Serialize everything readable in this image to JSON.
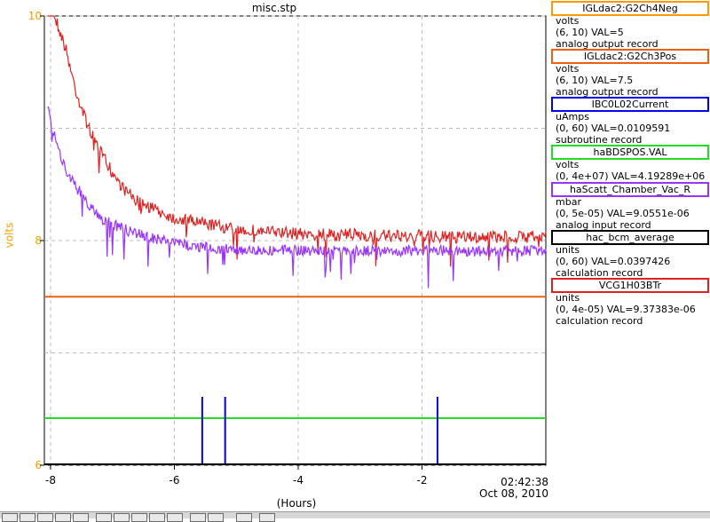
{
  "chart_data": {
    "type": "line",
    "title": "misc.stp",
    "xlabel": "(Hours)",
    "ylabel": "volts",
    "xlim": [
      -8.1,
      0
    ],
    "ylim": [
      6,
      10
    ],
    "x_ticks": [
      -8,
      -6,
      -4,
      -2
    ],
    "y_ticks": [
      6,
      8,
      10
    ],
    "timestamp": [
      "02:42:38",
      "Oct 08, 2010"
    ],
    "grid": true,
    "series": [
      {
        "name": "IGLdac2:G2Ch4Neg",
        "color": "#ff9900",
        "values": [
          5
        ]
      },
      {
        "name": "IGLdac2:G2Ch3Pos",
        "color": "#ee6010",
        "x": [
          -8.1,
          0
        ],
        "values": [
          7.5,
          7.5
        ]
      },
      {
        "name": "IBC0L02Current",
        "color": "#0000ee",
        "spikes_x": [
          -5.55,
          -5.18,
          -1.75
        ],
        "spikes_top": [
          0.0109,
          0.0109,
          0.0109
        ]
      },
      {
        "name": "haBDSPOS.VAL",
        "color": "#22dd22",
        "values": [
          4192890.0
        ]
      },
      {
        "name": "haScatt_Chamber_Vac_R",
        "color": "#9933ff",
        "x": [
          -8.05,
          -7.9,
          -7.75,
          -7.6,
          -7.45,
          -7.3,
          -7.15,
          -7.0,
          -6.8,
          -6.6,
          -6.4,
          -6.2,
          -6.0,
          -5.8,
          -5.6,
          -5.4,
          -5.2,
          -5.0,
          -4.5,
          -4.0,
          -3.5,
          -3.0,
          -2.5,
          -2.0,
          -1.5,
          -1.0,
          -0.5,
          0
        ],
        "values": [
          9.55e-06,
          8.55e-06,
          7.9e-06,
          7.5e-06,
          7.1e-06,
          6.8e-06,
          6.55e-06,
          6.45e-06,
          6.3e-06,
          6.2e-06,
          6.1e-06,
          6e-06,
          5.95e-06,
          5.88e-06,
          5.84e-06,
          5.8e-06,
          5.78e-06,
          5.76e-06,
          5.74e-06,
          5.73e-06,
          5.73e-06,
          5.73e-06,
          5.72e-06,
          5.73e-06,
          5.73e-06,
          5.72e-06,
          5.73e-06,
          5.73e-06
        ]
      },
      {
        "name": "hac_bcm_average",
        "color": "#000000",
        "values": [
          0.0397426
        ]
      },
      {
        "name": "VCG1H03BTr",
        "color": "#dd2222",
        "x": [
          -8.05,
          -7.9,
          -7.75,
          -7.6,
          -7.45,
          -7.3,
          -7.15,
          -7.0,
          -6.8,
          -6.6,
          -6.4,
          -6.2,
          -6.0,
          -5.8,
          -5.6,
          -5.4,
          -5.2,
          -5.0,
          -4.5,
          -4.0,
          -3.5,
          -3.0,
          -2.5,
          -2.0,
          -1.5,
          -1.0,
          -0.5,
          0
        ],
        "values": [
          4.2e-05,
          3.95e-05,
          3.7e-05,
          3.35e-05,
          3.1e-05,
          2.9e-05,
          2.75e-05,
          2.6e-05,
          2.45e-05,
          2.35e-05,
          2.3e-05,
          2.25e-05,
          2.2e-05,
          2.18e-05,
          2.16e-05,
          2.14e-05,
          2.12e-05,
          2.1e-05,
          2.08e-05,
          2.06e-05,
          2.05e-05,
          2.05e-05,
          2.04e-05,
          2.04e-05,
          2.03e-05,
          2.03e-05,
          2.03e-05,
          2.04e-05
        ]
      }
    ]
  },
  "legend": [
    {
      "name": "IGLdac2:G2Ch4Neg",
      "border": "#ff9900",
      "unit": "volts",
      "range_val": "(6, 10)  VAL=5",
      "record": "analog output record"
    },
    {
      "name": "IGLdac2:G2Ch3Pos",
      "border": "#ee6010",
      "unit": "volts",
      "range_val": "(6, 10)  VAL=7.5",
      "record": "analog output record"
    },
    {
      "name": "IBC0L02Current",
      "border": "#0000ee",
      "unit": "uAmps",
      "range_val": "(0, 60) VAL=0.0109591",
      "record": "subroutine record"
    },
    {
      "name": "haBDSPOS.VAL",
      "border": "#22dd22",
      "unit": "volts",
      "range_val": "(0, 4e+07) VAL=4.19289e+06",
      "record": ""
    },
    {
      "name": "haScatt_Chamber_Vac_R",
      "border": "#9933ff",
      "unit": "mbar",
      "range_val": "(0, 5e-05) VAL=9.0551e-06",
      "record": "analog input record"
    },
    {
      "name": "hac_bcm_average",
      "border": "#000000",
      "unit": "units",
      "range_val": "(0, 60) VAL=0.0397426",
      "record": "calculation record"
    },
    {
      "name": "VCG1H03BTr",
      "border": "#dd2222",
      "unit": "units",
      "range_val": "(0, 4e-05) VAL=9.37383e-06",
      "record": "calculation record"
    }
  ]
}
